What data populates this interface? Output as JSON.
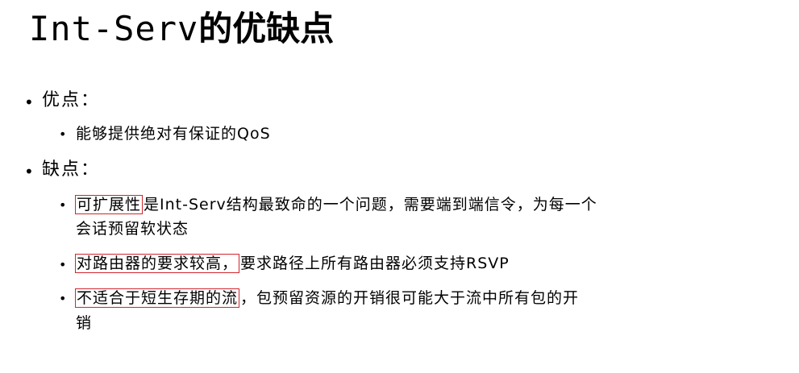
{
  "title": {
    "latin": "Int-Serv",
    "cjk": "的优缺点"
  },
  "bullet_glyph": "•",
  "accent_color": "#d0262d",
  "sections": {
    "pros": {
      "heading": "优点：",
      "items": [
        {
          "text": "能够提供绝对有保证的QoS"
        }
      ]
    },
    "cons": {
      "heading": "缺点：",
      "items": [
        {
          "highlight": "可扩展性",
          "rest_line1": "是Int-Serv结构最致命的一个问题，需要端到端信令，为每一个",
          "line2": "会话预留软状态"
        },
        {
          "highlight": "对路由器的要求较高，",
          "rest_line1": "要求路径上所有路由器必须支持RSVP"
        },
        {
          "highlight": "不适合于短生存期的流",
          "rest_line1": "，包预留资源的开销很可能大于流中所有包的开",
          "line2": "销"
        }
      ]
    }
  }
}
